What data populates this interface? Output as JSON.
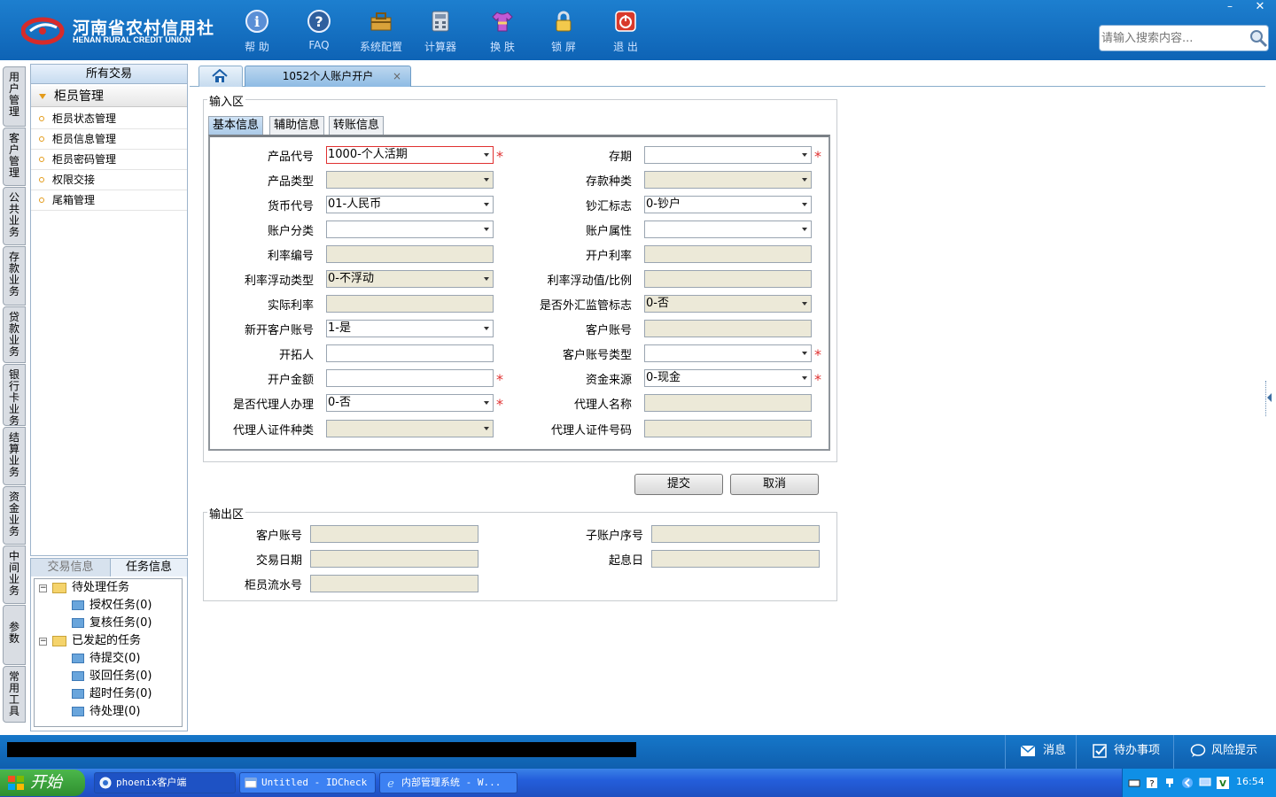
{
  "header": {
    "logo_cn": "河南省农村信用社",
    "logo_en": "HENAN RURAL CREDIT UNION",
    "toolbar": [
      {
        "label": "帮 助",
        "icon": "info-icon"
      },
      {
        "label": "FAQ",
        "icon": "question-icon"
      },
      {
        "label": "系统配置",
        "icon": "toolbox-icon"
      },
      {
        "label": "计算器",
        "icon": "calculator-icon"
      },
      {
        "label": "换 肤",
        "icon": "shirt-icon"
      },
      {
        "label": "锁 屏",
        "icon": "lock-icon"
      },
      {
        "label": "退 出",
        "icon": "power-icon"
      }
    ],
    "window_min": "–",
    "window_close": "✕",
    "search_placeholder": "请输入搜索内容..."
  },
  "vtabs": [
    "用户管理",
    "客户管理",
    "公共业务",
    "存款业务",
    "贷款业务",
    "银行卡业务",
    "结算业务",
    "资金业务",
    "中间业务",
    "参数",
    "常用工具"
  ],
  "leftpanel": {
    "header": "所有交易",
    "group": "柜员管理",
    "items": [
      "柜员状态管理",
      "柜员信息管理",
      "柜员密码管理",
      "权限交接",
      "尾箱管理"
    ]
  },
  "taskpanel": {
    "tab1": "交易信息",
    "tab2": "任务信息",
    "tree": {
      "pending": "待处理任务",
      "auth": "授权任务(0)",
      "review": "复核任务(0)",
      "initiated": "已发起的任务",
      "to_submit": "待提交(0)",
      "rejected": "驳回任务(0)",
      "timeout": "超时任务(0)",
      "to_process": "待处理(0)"
    }
  },
  "tabs": {
    "main_tab": "1052个人账户开户",
    "close": "×"
  },
  "input": {
    "legend": "输入区",
    "subtabs": [
      "基本信息",
      "辅助信息",
      "转账信息"
    ],
    "required_mark": "*",
    "fields": {
      "product_code": {
        "label": "产品代号",
        "value": "1000-个人活期"
      },
      "term": {
        "label": "存期",
        "value": ""
      },
      "product_type": {
        "label": "产品类型",
        "value": ""
      },
      "deposit_type": {
        "label": "存款种类",
        "value": ""
      },
      "currency": {
        "label": "货币代号",
        "value": "01-人民币"
      },
      "cash_flag": {
        "label": "钞汇标志",
        "value": "0-钞户"
      },
      "account_class": {
        "label": "账户分类",
        "value": ""
      },
      "account_attr": {
        "label": "账户属性",
        "value": ""
      },
      "rate_code": {
        "label": "利率编号",
        "value": ""
      },
      "open_rate": {
        "label": "开户利率",
        "value": ""
      },
      "rate_float_type": {
        "label": "利率浮动类型",
        "value": "0-不浮动"
      },
      "rate_float_value": {
        "label": "利率浮动值/比例",
        "value": ""
      },
      "actual_rate": {
        "label": "实际利率",
        "value": ""
      },
      "fx_flag": {
        "label": "是否外汇监管标志",
        "value": "0-否"
      },
      "new_account": {
        "label": "新开客户账号",
        "value": "1-是"
      },
      "customer_account": {
        "label": "客户账号",
        "value": ""
      },
      "developer": {
        "label": "开拓人",
        "value": ""
      },
      "customer_account_type": {
        "label": "客户账号类型",
        "value": ""
      },
      "open_amount": {
        "label": "开户金额",
        "value": ""
      },
      "fund_source": {
        "label": "资金来源",
        "value": "0-现金"
      },
      "agent_flag": {
        "label": "是否代理人办理",
        "value": "0-否"
      },
      "agent_name": {
        "label": "代理人名称",
        "value": ""
      },
      "agent_id_type": {
        "label": "代理人证件种类",
        "value": ""
      },
      "agent_id_no": {
        "label": "代理人证件号码",
        "value": ""
      }
    }
  },
  "buttons": {
    "submit": "提交",
    "cancel": "取消"
  },
  "output": {
    "legend": "输出区",
    "customer_account": "客户账号",
    "sub_account_no": "子账户序号",
    "trade_date": "交易日期",
    "value_date": "起息日",
    "teller_serial": "柜员流水号"
  },
  "statusbar": {
    "message": "消息",
    "todo": "待办事项",
    "risk": "风险提示"
  },
  "taskbar": {
    "start": "开始",
    "tasks": [
      "phoenix客户端",
      "Untitled - IDCheck",
      "内部管理系统 - W..."
    ],
    "clock": "16:54"
  },
  "colors": {
    "header_blue": "#1d7fcf",
    "required_red": "#e03131",
    "readonly_bg": "#ece9d8"
  }
}
